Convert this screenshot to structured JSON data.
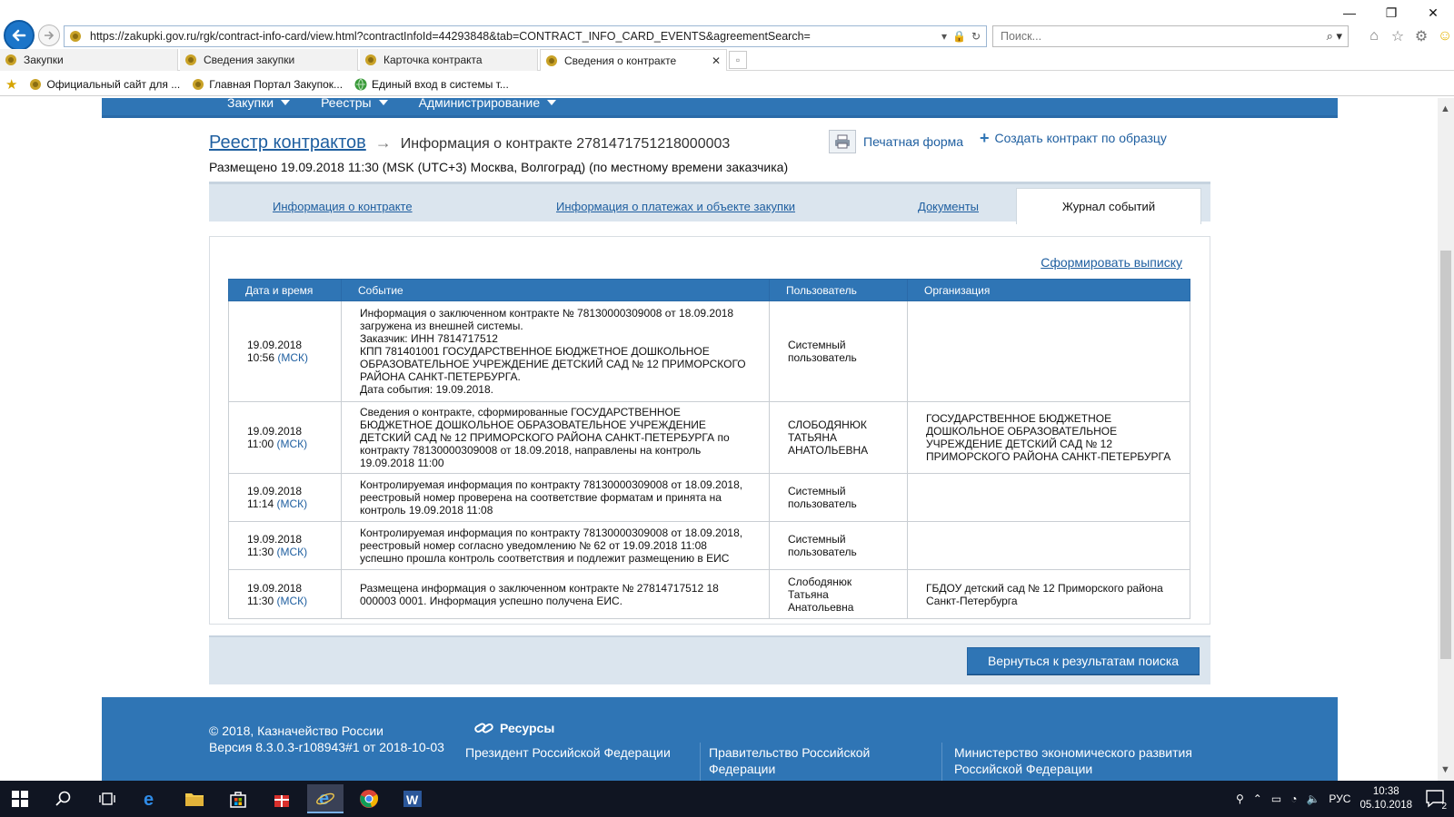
{
  "browser": {
    "url": "https://zakupki.gov.ru/rgk/contract-info-card/view.html?contractInfoId=44293848&tab=CONTRACT_INFO_CARD_EVENTS&agreementSearch=",
    "search_placeholder": "Поиск...",
    "tabs": [
      {
        "label": "Закупки"
      },
      {
        "label": "Сведения закупки"
      },
      {
        "label": "Карточка контракта"
      },
      {
        "label": "Сведения о контракте"
      }
    ],
    "favorites": [
      {
        "label": "Официальный сайт для ..."
      },
      {
        "label": "Главная Портал Закупок..."
      },
      {
        "label": "Единый вход в системы т..."
      }
    ]
  },
  "site_menu": {
    "items": [
      {
        "label": "Закупки"
      },
      {
        "label": "Реестры"
      },
      {
        "label": "Администрирование"
      }
    ]
  },
  "header": {
    "breadcrumb_link": "Реестр контрактов",
    "current": "Информация о контракте 2781471751218000003",
    "posted": "Размещено 19.09.2018 11:30 (MSK (UTC+3) Москва, Волгоград) (по местному времени заказчика)",
    "print_label": "Печатная форма",
    "create_label": "Создать контракт по образцу"
  },
  "page_tabs": {
    "info": "Информация о контракте",
    "payments": "Информация о платежах и объекте закупки",
    "docs": "Документы",
    "journal": "Журнал событий"
  },
  "panel": {
    "extract_link": "Сформировать выписку"
  },
  "table": {
    "headers": [
      "Дата и время",
      "Событие",
      "Пользователь",
      "Организация"
    ],
    "rows": [
      {
        "date": "19.09.2018",
        "time": "10:56",
        "tz": "(МСК)",
        "event": "Информация о заключенном контракте № 78130000309008 от 18.09.2018 загружена из внешней системы.\nЗаказчик: ИНН 7814717512\nКПП 781401001 ГОСУДАРСТВЕННОЕ БЮДЖЕТНОЕ ДОШКОЛЬНОЕ ОБРАЗОВАТЕЛЬНОЕ УЧРЕЖДЕНИЕ ДЕТСКИЙ САД № 12 ПРИМОРСКОГО РАЙОНА САНКТ-ПЕТЕРБУРГА.\nДата события: 19.09.2018.",
        "user": "Системный пользователь",
        "org": ""
      },
      {
        "date": "19.09.2018",
        "time": "11:00",
        "tz": "(МСК)",
        "event": "Сведения о контракте, сформированные ГОСУДАРСТВЕННОЕ БЮДЖЕТНОЕ ДОШКОЛЬНОЕ ОБРАЗОВАТЕЛЬНОЕ УЧРЕЖДЕНИЕ ДЕТСКИЙ САД № 12 ПРИМОРСКОГО РАЙОНА САНКТ-ПЕТЕРБУРГА по контракту 78130000309008 от 18.09.2018, направлены на контроль 19.09.2018 11:00",
        "user": "СЛОБОДЯНЮК ТАТЬЯНА АНАТОЛЬЕВНА",
        "org": "ГОСУДАРСТВЕННОЕ БЮДЖЕТНОЕ ДОШКОЛЬНОЕ ОБРАЗОВАТЕЛЬНОЕ УЧРЕЖДЕНИЕ ДЕТСКИЙ САД № 12 ПРИМОРСКОГО РАЙОНА САНКТ-ПЕТЕРБУРГА"
      },
      {
        "date": "19.09.2018",
        "time": "11:14",
        "tz": "(МСК)",
        "event": "Контролируемая информация по контракту 78130000309008 от 18.09.2018, реестровый номер проверена на соответствие форматам и принята на контроль 19.09.2018 11:08",
        "user": "Системный пользователь",
        "org": ""
      },
      {
        "date": "19.09.2018",
        "time": "11:30",
        "tz": "(МСК)",
        "event": "Контролируемая информация по контракту 78130000309008 от 18.09.2018, реестровый номер согласно уведомлению № 62 от 19.09.2018 11:08 успешно прошла контроль соответствия и подлежит размещению в ЕИС",
        "user": "Системный пользователь",
        "org": ""
      },
      {
        "date": "19.09.2018",
        "time": "11:30",
        "tz": "(МСК)",
        "event": "Размещена информация о заключенном контракте № 27814717512 18 000003 0001. Информация успешно получена ЕИС.",
        "user": "Слободянюк Татьяна Анатольевна",
        "org": "ГБДОУ детский сад № 12 Приморского района Санкт-Петербурга"
      }
    ]
  },
  "bottom": {
    "back_label": "Вернуться к результатам поиска"
  },
  "footer": {
    "copyright": "© 2018, Казначейство России",
    "version": "Версия 8.3.0.3-r108943#1 от 2018-10-03",
    "resources_title": "Ресурсы",
    "links": [
      "Президент Российской Федерации",
      "Правительство Российской Федерации",
      "Министерство экономического развития Российской Федерации"
    ]
  },
  "taskbar": {
    "lang": "РУС",
    "time": "10:38",
    "date": "05.10.2018",
    "notifications": "2"
  },
  "colors": {
    "brand_blue": "#2f75b5",
    "link_blue": "#1f5fa0"
  }
}
